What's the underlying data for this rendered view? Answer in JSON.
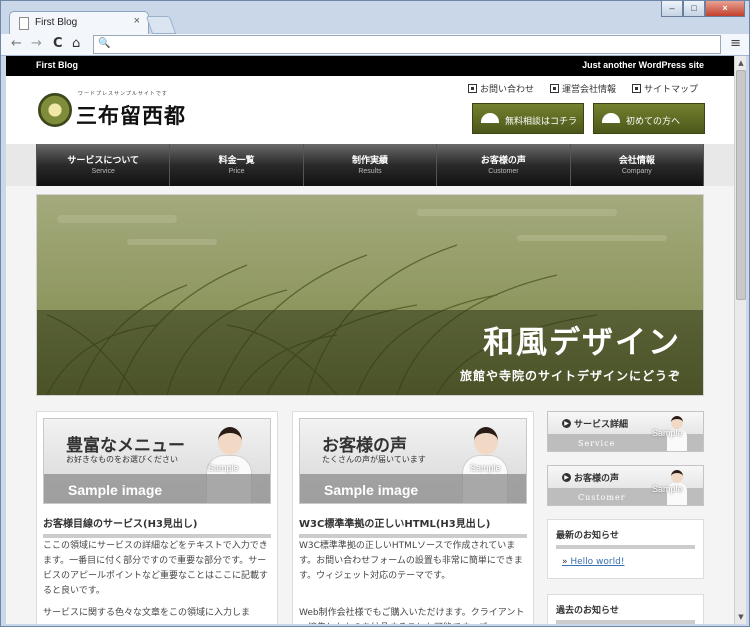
{
  "browser": {
    "tab_title": "First Blog",
    "tab_close": "×",
    "win_minimize": "–",
    "win_maximize": "□",
    "win_close": "×",
    "back": "←",
    "forward": "→",
    "reload": "C",
    "home": "⌂",
    "menu": "≡",
    "search_glyph": "🔍",
    "address_value": ""
  },
  "site": {
    "name": "First Blog",
    "tagline": "Just another WordPress site",
    "logo_ruby": "ワードプレスサンプルサイトです",
    "logo_text": "三布留西都",
    "util_links": [
      {
        "label": "お問い合わせ",
        "icon": "contact-icon"
      },
      {
        "label": "運営会社情報",
        "icon": "company-icon"
      },
      {
        "label": "サイトマップ",
        "icon": "sitemap-icon"
      }
    ],
    "cta": [
      {
        "label": "無料相談はコチラ"
      },
      {
        "label": "初めての方へ"
      }
    ],
    "nav": [
      {
        "jp": "サービスについて",
        "en": "Service"
      },
      {
        "jp": "料金一覧",
        "en": "Price"
      },
      {
        "jp": "制作実績",
        "en": "Results"
      },
      {
        "jp": "お客様の声",
        "en": "Customer"
      },
      {
        "jp": "会社情報",
        "en": "Company"
      }
    ],
    "hero": {
      "title": "和風デザイン",
      "subtitle": "旅館や寺院のサイトデザインにどうぞ"
    },
    "columns": [
      {
        "banner_title": "豊富なメニュー",
        "banner_sub": "お好きなものをお選びください",
        "banner_sample": "Sample",
        "banner_strip": "Sample image",
        "heading": "お客様目線のサービス(H3見出し)",
        "p1": "ここの領域にサービスの詳細などをテキストで入力できます。一番目に付く部分ですので重要な部分です。サービスのアピールポイントなど重要なことはここに記載すると良いです。",
        "p2": "サービスに関する色々な文章をこの領域に入力しま"
      },
      {
        "banner_title": "お客様の声",
        "banner_sub": "たくさんの声が届いています",
        "banner_sample": "Sample",
        "banner_strip": "Sample image",
        "heading": "W3C標準準拠の正しいHTML(H3見出し)",
        "p1": "W3C標準準拠の正しいHTMLソースで作成されています。お問い合わせフォームの設置も非常に簡単にできます。ウィジェット対応のテーマです。",
        "p2": "Web制作会社様でもご購入いただけます。クライアントへ編集したものを納品することも可能です。ご"
      }
    ],
    "sidebar": {
      "banners": [
        {
          "title": "サービス詳細",
          "en": "Service",
          "sample": "Sample"
        },
        {
          "title": "お客様の声",
          "en": "Customer",
          "sample": "Sample"
        }
      ],
      "news_heading": "最新のお知らせ",
      "news_link": "Hello world!",
      "past_heading": "過去のお知らせ"
    }
  },
  "colors": {
    "accent_olive": "#5d6a22",
    "nav_dark": "#2a2a2a",
    "link_blue": "#3a6fb0"
  }
}
